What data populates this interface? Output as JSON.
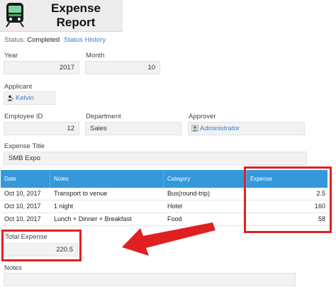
{
  "header": {
    "title_line1": "Expense",
    "title_line2": "Report",
    "icon": "train-icon"
  },
  "status": {
    "label": "Status:",
    "value": "Completed",
    "history_link": "Status History"
  },
  "fields": {
    "year": {
      "label": "Year",
      "value": "2017"
    },
    "month": {
      "label": "Month",
      "value": "10"
    },
    "applicant": {
      "label": "Applicant",
      "value": "Kelvin"
    },
    "employee_id": {
      "label": "Employee ID",
      "value": "12"
    },
    "department": {
      "label": "Department",
      "value": "Sales"
    },
    "approver": {
      "label": "Approver",
      "value": "Administrator"
    },
    "expense_title": {
      "label": "Expense Title",
      "value": "SMB Expo"
    },
    "total_expense": {
      "label": "Total Expense",
      "value": "220.5"
    },
    "notes": {
      "label": "Notes",
      "value": ""
    }
  },
  "table": {
    "headers": [
      "Date",
      "Notes",
      "Category",
      "Expense"
    ],
    "rows": [
      [
        "Oct 10, 2017",
        "Transport to venue",
        "Bus(round-trip)",
        "2.5"
      ],
      [
        "Oct 10, 2017",
        "1 night",
        "Hotel",
        "160"
      ],
      [
        "Oct 10, 2017",
        "Lunch + Dinner + Breakfast",
        "Food",
        "58"
      ]
    ]
  },
  "colors": {
    "accent": "#3498db",
    "highlight": "#e02020",
    "link": "#3a7cc4"
  }
}
